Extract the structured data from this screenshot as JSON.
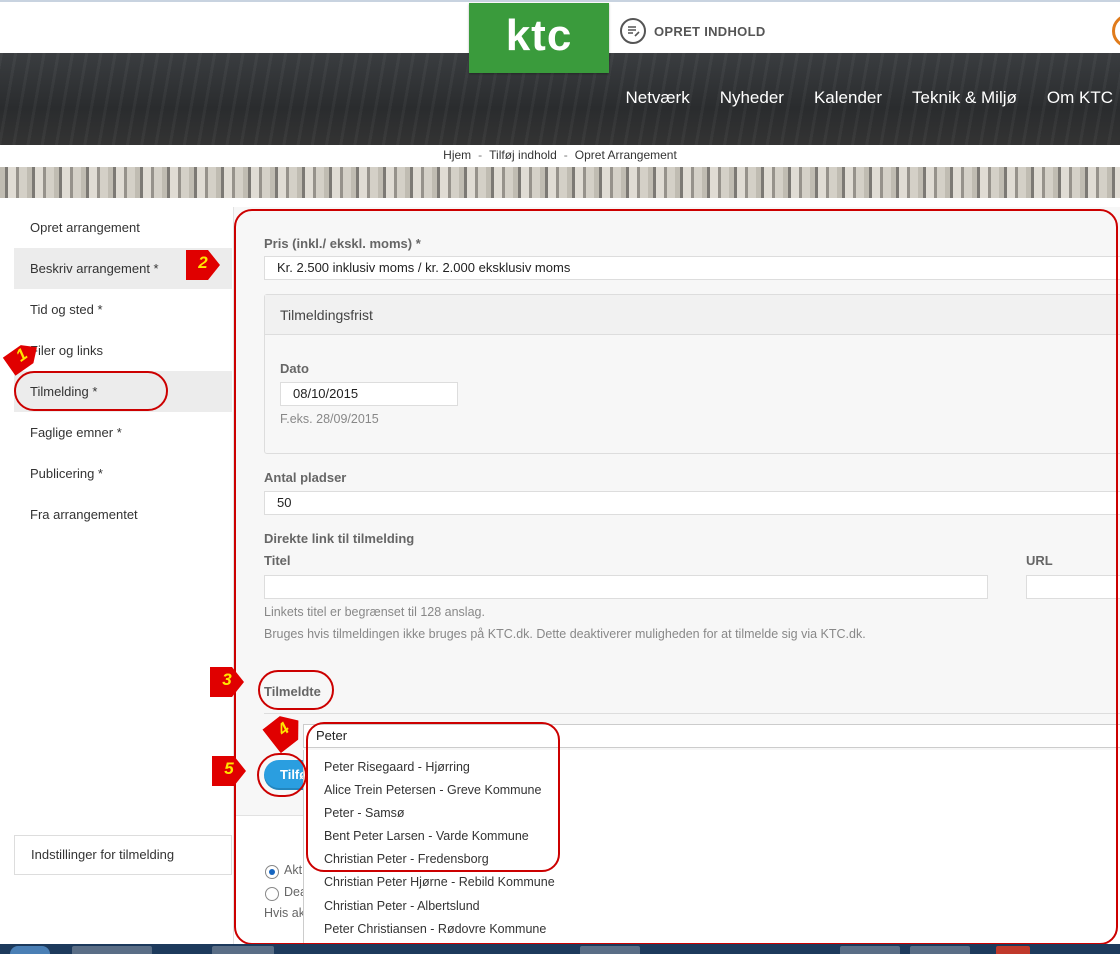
{
  "header": {
    "logo_text": "ktc",
    "create_label": "OPRET INDHOLD",
    "nav": [
      "Netværk",
      "Nyheder",
      "Kalender",
      "Teknik & Miljø",
      "Om KTC"
    ]
  },
  "breadcrumb": [
    "Hjem",
    "Tilføj indhold",
    "Opret Arrangement"
  ],
  "sidebar": {
    "items": [
      {
        "label": "Opret arrangement"
      },
      {
        "label": "Beskriv arrangement *"
      },
      {
        "label": "Tid og sted *"
      },
      {
        "label": "Filer og links"
      },
      {
        "label": "Tilmelding *"
      },
      {
        "label": "Faglige emner *"
      },
      {
        "label": "Publicering *"
      },
      {
        "label": "Fra arrangementet"
      }
    ],
    "settings_label": "Indstillinger for tilmelding"
  },
  "form": {
    "price_label": "Pris (inkl./ ekskl. moms) *",
    "price_value": "Kr. 2.500 inklusiv moms / kr. 2.000 eksklusiv moms",
    "deadline_legend": "Tilmeldingsfrist",
    "date_label": "Dato",
    "date_value": "08/10/2015",
    "date_hint": "F.eks. 28/09/2015",
    "seats_label": "Antal pladser",
    "seats_value": "50",
    "direct_link_label": "Direkte link til tilmelding",
    "title_label": "Titel",
    "url_label": "URL",
    "hint_1": "Linkets titel er begrænset til 128 anslag.",
    "hint_2": "Bruges hvis tilmeldingen ikke bruges på KTC.dk. Dette deaktiverer muligheden for at tilmelde sig via KTC.dk.",
    "registered_label": "Tilmeldte",
    "search_value": "Peter",
    "add_button_label": "Tilfø"
  },
  "autocomplete": [
    "Peter Risegaard - Hjørring",
    "Alice Trein Petersen - Greve Kommune",
    "Peter - Samsø",
    "Bent Peter Larsen - Varde Kommune",
    "Christian Peter - Fredensborg",
    "Christian Peter Hjørne - Rebild Kommune",
    "Christian Peter - Albertslund",
    "Peter Christiansen - Rødovre Kommune"
  ],
  "status": {
    "radio_active": "Akt",
    "radio_deactive": "Dea",
    "hint": "Hvis ak"
  },
  "markers": [
    "1",
    "2",
    "3",
    "4",
    "5"
  ],
  "colors": {
    "brand_green": "#3a9b3c",
    "annotation_red": "#cc0000",
    "button_blue": "#2a9ee0"
  }
}
